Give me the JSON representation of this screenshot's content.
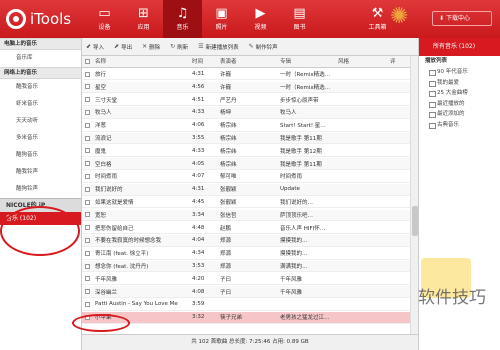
{
  "app": {
    "name": "iTools"
  },
  "nav": [
    {
      "label": "设备",
      "icon": "device-icon"
    },
    {
      "label": "应用",
      "icon": "apps-icon"
    },
    {
      "label": "音乐",
      "icon": "music-note-icon",
      "active": true
    },
    {
      "label": "照片",
      "icon": "photo-icon"
    },
    {
      "label": "视频",
      "icon": "video-icon"
    },
    {
      "label": "图书",
      "icon": "book-icon"
    },
    {
      "label": "",
      "icon": "blank-icon"
    },
    {
      "label": "工具箱",
      "icon": "toolbox-icon"
    }
  ],
  "download_label": "下载中心",
  "sidebar": {
    "pc_section": "电脑上的音乐",
    "pc_items": [
      "音乐库"
    ],
    "net_section": "网络上的音乐",
    "net_items": [
      "酷我音乐",
      "虾米音乐",
      "天天动听",
      "多米音乐",
      "酷狗音乐",
      "酷我铃声",
      "酷狗铃声"
    ],
    "device_name": "NICOLE的 iP",
    "selected": "音乐 (102)"
  },
  "toolbar": [
    {
      "label": "导入",
      "icon": "import-icon"
    },
    {
      "label": "导出",
      "icon": "export-icon"
    },
    {
      "label": "删除",
      "icon": "delete-icon"
    },
    {
      "label": "刷新",
      "icon": "refresh-icon"
    },
    {
      "label": "新建播放列表",
      "icon": "new-playlist-icon"
    },
    {
      "label": "制作铃声",
      "icon": "ringtone-icon"
    }
  ],
  "table": {
    "headers": [
      "名称",
      "时间",
      "表演者",
      "专辑",
      "风格",
      "评"
    ],
    "rows": [
      [
        "旅行",
        "4:31",
        "许巍",
        "一时（Remix精选…",
        "",
        ""
      ],
      [
        "星空",
        "4:56",
        "许巍",
        "一时（Remix精选…",
        "",
        ""
      ],
      [
        "三寸天堂",
        "4:51",
        "严艺丹",
        "步步惊心原声带",
        "",
        ""
      ],
      [
        "牧马人",
        "4:33",
        "杨坤",
        "牧马人",
        "",
        ""
      ],
      [
        "洋葱",
        "4:06",
        "杨宗纬",
        "Start! Start! 星…",
        "",
        ""
      ],
      [
        "流浪记",
        "3:55",
        "杨宗纬",
        "我是歌手 第11期",
        "",
        ""
      ],
      [
        "魔鬼",
        "4:33",
        "杨宗纬",
        "我是歌手 第12期",
        "",
        ""
      ],
      [
        "空白格",
        "4:05",
        "杨宗纬",
        "我是歌手 第11期",
        "",
        ""
      ],
      [
        "时间煮雨",
        "4:07",
        "郁可唯",
        "时间煮雨",
        "",
        ""
      ],
      [
        "我们说好的",
        "4:31",
        "张靓颖",
        "Update",
        "",
        ""
      ],
      [
        "如果这就是爱情",
        "4:45",
        "张靓颖",
        "我们说好的…",
        "",
        ""
      ],
      [
        "宽恕",
        "3:34",
        "张信哲",
        "萨顶顶乐吧…",
        "",
        ""
      ],
      [
        "把悲伤留给自己",
        "4:48",
        "赵鹏",
        "音乐人声 HIFI怀…",
        "",
        ""
      ],
      [
        "不要在我寂寞的时候想念我",
        "4:04",
        "郑源",
        "摸摸我的…",
        "",
        ""
      ],
      [
        "寄江南 (feat. 徐立平)",
        "4:34",
        "郑源",
        "摸摸我的…",
        "",
        ""
      ],
      [
        "想念你 (feat. 沈丹丹)",
        "3:53",
        "郑源",
        "满满我的…",
        "",
        ""
      ],
      [
        "千年风雅",
        "4:20",
        "子曰",
        "千年风雅",
        "",
        ""
      ],
      [
        "深谷幽兰",
        "4:08",
        "子曰",
        "千年风雅",
        "",
        ""
      ],
      [
        "Patti Austin - Say You Love Me",
        "3:59",
        "",
        "",
        "",
        ""
      ],
      [
        "小苹果",
        "3:32",
        "筷子兄弟",
        "老男孩之猛龙过江…",
        "",
        ""
      ]
    ],
    "highlighted_row": 19
  },
  "right_panel": {
    "title": "所有音乐 (102)",
    "subtitle": "播放列表",
    "playlists": [
      "90 年代音乐",
      "我的最爱",
      "25 大金曲榜",
      "最近播放的",
      "最近添加的",
      "古典音乐"
    ]
  },
  "status": "共 102 首歌曲    总长度: 7:25:46    占用: 0.89 GB",
  "watermark": "软件技巧"
}
